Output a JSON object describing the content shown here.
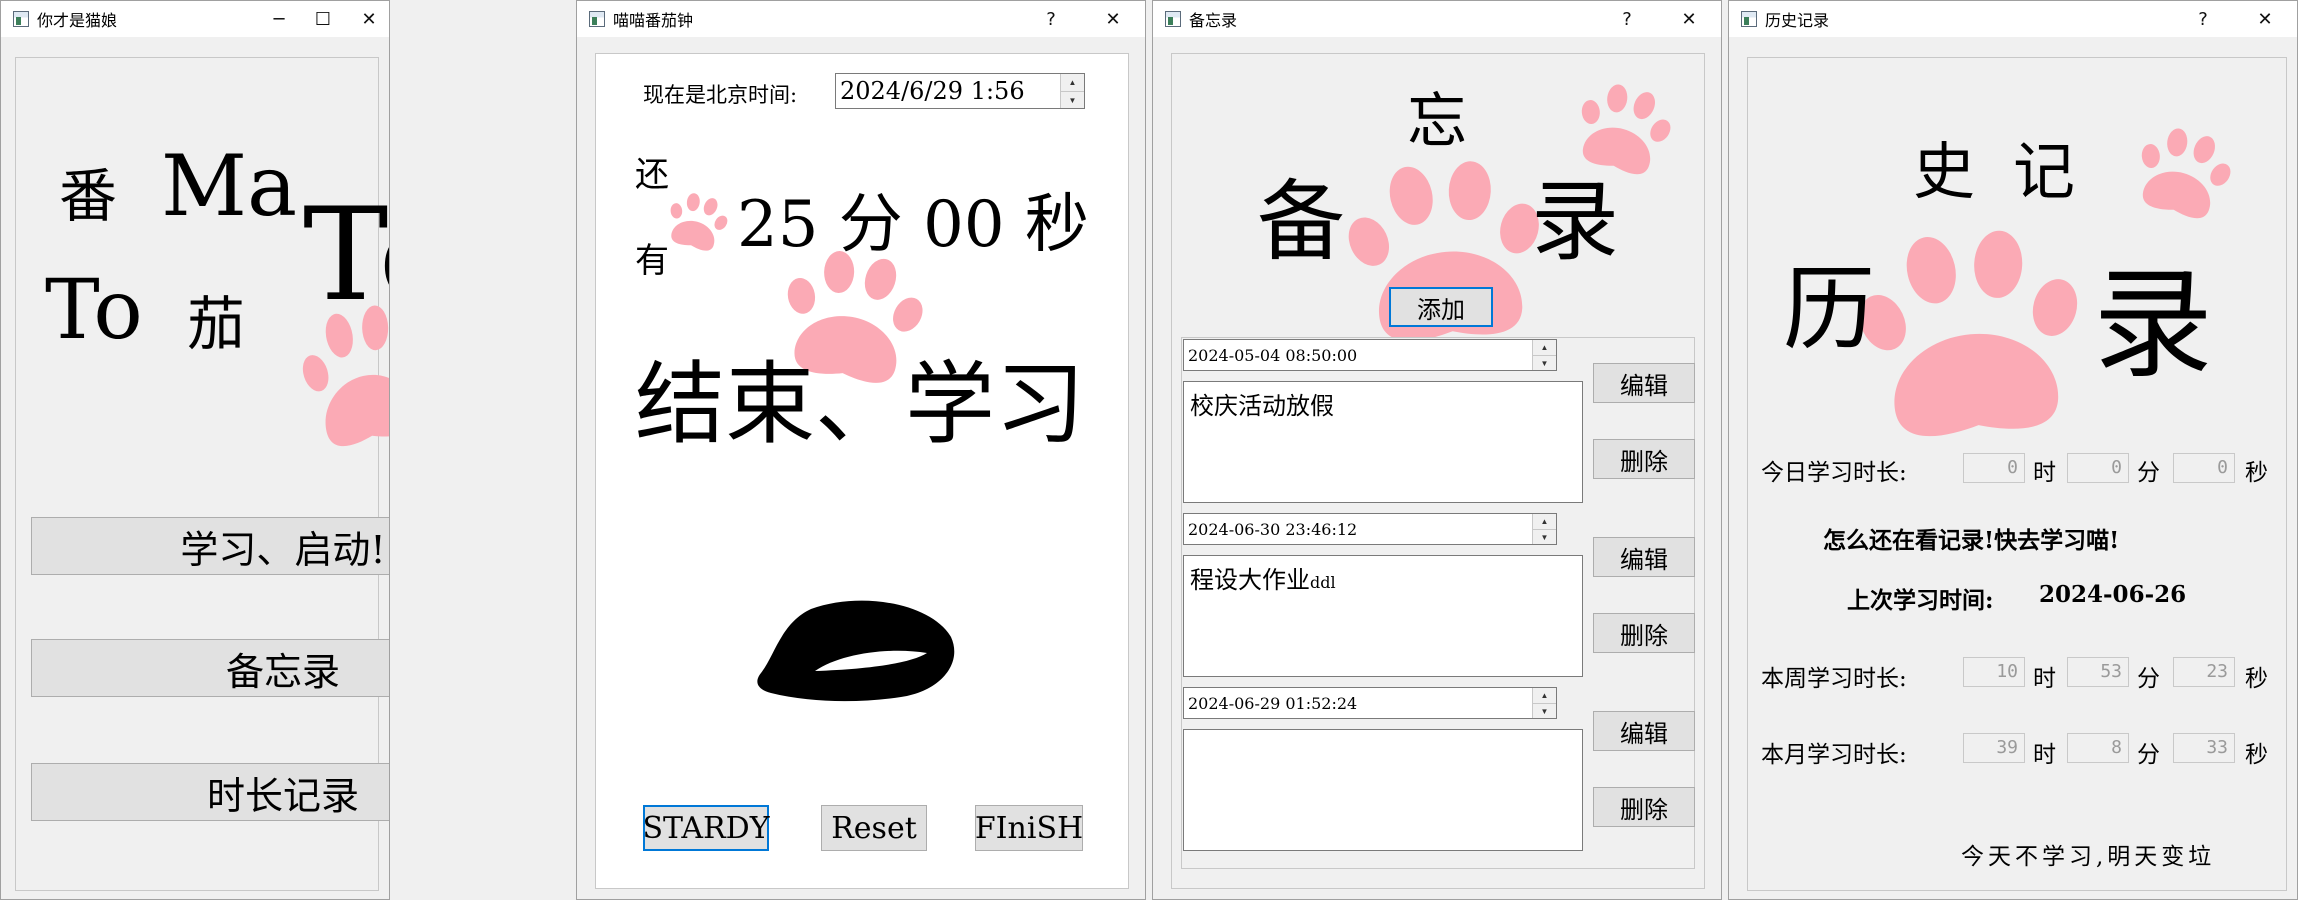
{
  "colors": {
    "paw": "#fbaab5",
    "title_bg": "#ffffff",
    "window_bg": "#f0f0f0",
    "focus_border": "#0078d7"
  },
  "window1": {
    "title": "你才是猫娘",
    "controls": {
      "minimize": "─",
      "maximize": "☐",
      "close": "✕"
    },
    "logo_chars": {
      "fan": "番",
      "ma": "Ma",
      "to_left": "To",
      "qie": "茄",
      "to_big": "To",
      "exclaim": "!"
    },
    "buttons": {
      "study": "学习、启动!",
      "memo": "备忘录",
      "history": "时长记录"
    }
  },
  "window2": {
    "title": "喵喵番茄钟",
    "controls": {
      "help": "?",
      "close": "✕"
    },
    "time_label": "现在是北京时间:",
    "datetime_value": "2024/6/29 1:56",
    "remaining_prefix_1": "还",
    "remaining_prefix_2": "有",
    "countdown": "25 分 00 秒",
    "status": "结束、学习",
    "buttons": {
      "start": "STARDY",
      "reset": "Reset",
      "finish": "FIniSH"
    }
  },
  "window3": {
    "title": "备忘录",
    "controls": {
      "help": "?",
      "close": "✕"
    },
    "heading": {
      "bei": "备",
      "wang": "忘",
      "lu": "录"
    },
    "add_button": "添加",
    "edit_label": "编辑",
    "delete_label": "删除",
    "memos": [
      {
        "datetime": "2024-05-04 08:50:00",
        "text": "校庆活动放假",
        "text_suffix": ""
      },
      {
        "datetime": "2024-06-30 23:46:12",
        "text": "程设大作业",
        "text_suffix": "ddl"
      },
      {
        "datetime": "2024-06-29 01:52:24",
        "text": "",
        "text_suffix": ""
      }
    ]
  },
  "window4": {
    "title": "历史记录",
    "controls": {
      "help": "?",
      "close": "✕"
    },
    "heading": {
      "li": "历",
      "shi": "史",
      "ji": "记",
      "lu": "录"
    },
    "today_label": "今日学习时长:",
    "today": {
      "h": "0",
      "m": "0",
      "s": "0"
    },
    "nag": "怎么还在看记录!快去学习喵!",
    "last_study_label": "上次学习时间:",
    "last_study_date": "2024-06-26",
    "week_label": "本周学习时长:",
    "week": {
      "h": "10",
      "m": "53",
      "s": "23"
    },
    "month_label": "本月学习时长:",
    "month": {
      "h": "39",
      "m": "8",
      "s": "33"
    },
    "units": {
      "h": "时",
      "m": "分",
      "s": "秒"
    },
    "footer": "今天不学习,明天变垃"
  }
}
